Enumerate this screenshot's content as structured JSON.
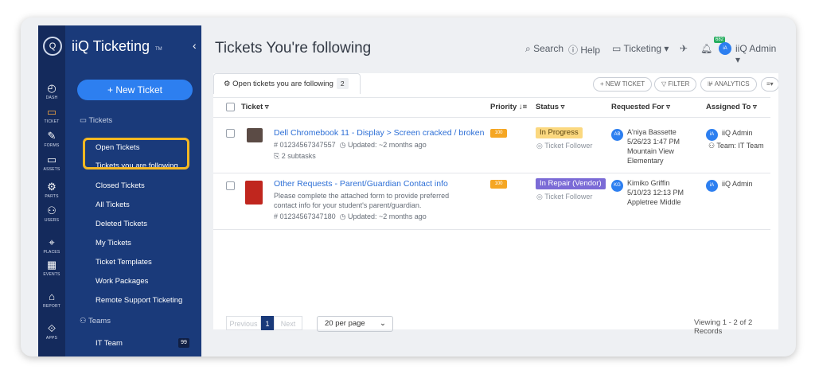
{
  "brand": {
    "name": "iiQ Ticketing",
    "tm": "TM"
  },
  "rail": [
    {
      "icon": "◴",
      "label": "DASH"
    },
    {
      "icon": "▭",
      "label": "TICKET"
    },
    {
      "icon": "✎",
      "label": "FORMS"
    },
    {
      "icon": "▭",
      "label": "ASSETS"
    },
    {
      "icon": "⚙",
      "label": "PARTS"
    },
    {
      "icon": "⚇",
      "label": "USERS"
    },
    {
      "icon": "⌖",
      "label": "PLACES"
    },
    {
      "icon": "▦",
      "label": "EVENTS"
    },
    {
      "icon": "⌂",
      "label": "REPORT"
    },
    {
      "icon": "⟐",
      "label": "APPS"
    }
  ],
  "sidebar": {
    "new_ticket": "+ New Ticket",
    "tickets_header": "Tickets",
    "items": [
      "Open Tickets",
      "Tickets you are following",
      "Closed Tickets",
      "All Tickets",
      "Deleted Tickets",
      "My Tickets",
      "Ticket Templates",
      "Work Packages",
      "Remote Support Ticketing"
    ],
    "teams_header": "Teams",
    "team": {
      "name": "IT Team",
      "count": "99"
    }
  },
  "header": {
    "title": "Tickets You're following",
    "search": "Search",
    "help": "Help",
    "module": "Ticketing",
    "notifications": "682",
    "user_initials": "iA",
    "user": "iiQ Admin"
  },
  "toolbar": {
    "tab_label": "Open tickets you are following",
    "tab_count": "2",
    "new_ticket": "+ NEW TICKET",
    "filter": "FILTER",
    "analytics": "ANALYTICS"
  },
  "columns": {
    "ticket": "Ticket",
    "priority": "Priority",
    "status": "Status",
    "requested_for": "Requested For",
    "assigned_to": "Assigned To"
  },
  "rows": [
    {
      "title": "Dell Chromebook 11 - Display > Screen cracked / broken",
      "number": "# 01234567347557",
      "updated": "Updated: ~2 months ago",
      "subtasks": "2 subtasks",
      "priority": "100",
      "status": "In Progress",
      "follower": "Ticket Follower",
      "req_initials": "AB",
      "req_name": "A'niya Bassette",
      "req_date": "5/26/23 1:47 PM",
      "req_location": "Mountain View Elementary",
      "assigned_initials": "iA",
      "assigned": "iiQ Admin",
      "team": "Team: IT Team"
    },
    {
      "title": "Other Requests - Parent/Guardian Contact info",
      "description": "Please complete the attached form to provide preferred contact info for your student's parent/guardian.",
      "number": "# 01234567347180",
      "updated": "Updated: ~2 months ago",
      "priority": "100",
      "status": "In Repair (Vendor)",
      "follower": "Ticket Follower",
      "req_initials": "KG",
      "req_name": "Kimiko Griffin",
      "req_date": "5/10/23 12:13 PM",
      "req_location": "Appletree Middle",
      "assigned_initials": "iA",
      "assigned": "iiQ Admin"
    }
  ],
  "pagination": {
    "previous": "Previous",
    "page": "1",
    "next": "Next",
    "per_page": "20 per page",
    "records": "Viewing 1 - 2 of 2 Records"
  },
  "colors": {
    "sidebar": "#1a3a7a",
    "rail": "#142a5c",
    "accent": "#2d7ff0",
    "highlight": "#f5b822",
    "in_progress": "#fbd87f",
    "in_repair": "#7b6bd6"
  }
}
